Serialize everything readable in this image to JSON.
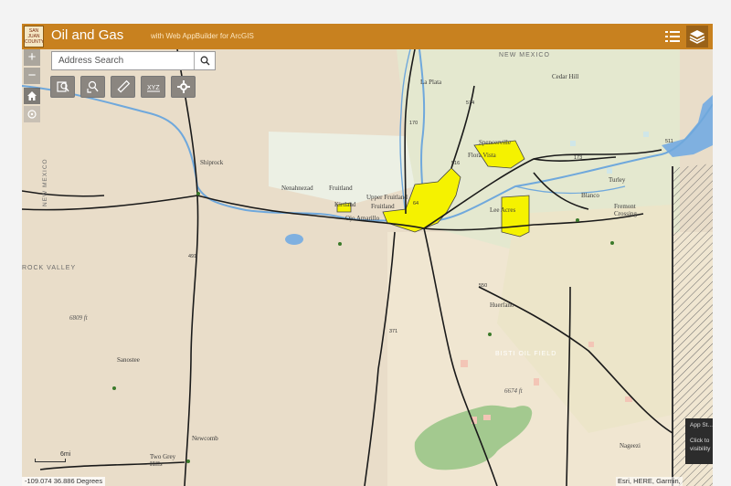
{
  "header": {
    "logo_text": "SAN JUAN COUNTY",
    "title": "Oil and Gas",
    "subtitle": "with Web AppBuilder for ArcGIS",
    "legend_icon": "list-icon",
    "layers_icon": "layers-icon"
  },
  "zoom": {
    "in": "+",
    "out": "−"
  },
  "search": {
    "placeholder": "Address Search"
  },
  "tools": [
    {
      "name": "query-tool",
      "icon": "search-map-icon"
    },
    {
      "name": "select-tool",
      "icon": "search-features-icon"
    },
    {
      "name": "measure-tool",
      "icon": "ruler-icon"
    },
    {
      "name": "coordinate-tool",
      "icon": "xy-icon"
    },
    {
      "name": "settings-tool",
      "icon": "gear-icon"
    }
  ],
  "coordinates": "-109.074 36.886 Degrees",
  "attribution": "Esri, HERE, Garmin,",
  "scale_label": "6mi",
  "splash": {
    "title": "App St...",
    "line1": "Click to",
    "line2": "visibility"
  },
  "places": {
    "new_mexico_top": "NEW MEXICO",
    "new_mexico_left": "NEW MEXICO",
    "la_plata": "La Plata",
    "cedar_hill": "Cedar Hill",
    "spencerville": "Spencerville",
    "flora_vista": "Flora Vista",
    "shiprock": "Shiprock",
    "nenahnezad": "Nenahnezad",
    "fruitland_upper": "Fruitland",
    "upper_fruitland": "Upper Fruitland",
    "kirtland": "Kirtland",
    "fruitland": "Fruitland",
    "ojo_amarillo": "Ojo Amarillo",
    "lee_acres": "Lee Acres",
    "blanco": "Blanco",
    "turley": "Turley",
    "fremont_crossing": "Fremont Crossing",
    "huerfano": "Huerfano",
    "bisti_oil_field": "BISTI OIL FIELD",
    "sanostee": "Sanostee",
    "newcomb": "Newcomb",
    "two_grey_hills": "Two Grey Hills",
    "naageezi": "Nageezi",
    "rock_valley": "ROCK VALLEY",
    "elev_6809": "6809 ft",
    "elev_6674": "6674 ft",
    "route_491": "491",
    "route_550": "550",
    "route_371": "371",
    "route_64": "64",
    "route_574": "574",
    "route_170": "170",
    "route_173": "173",
    "route_516": "516",
    "route_511": "511"
  },
  "colors": {
    "header": "#c8811f",
    "oil_gas_fields": "#f5f200",
    "rivers": "#6fa8dc",
    "roads": "#1a1a1a",
    "forest": "#a3c98f"
  }
}
